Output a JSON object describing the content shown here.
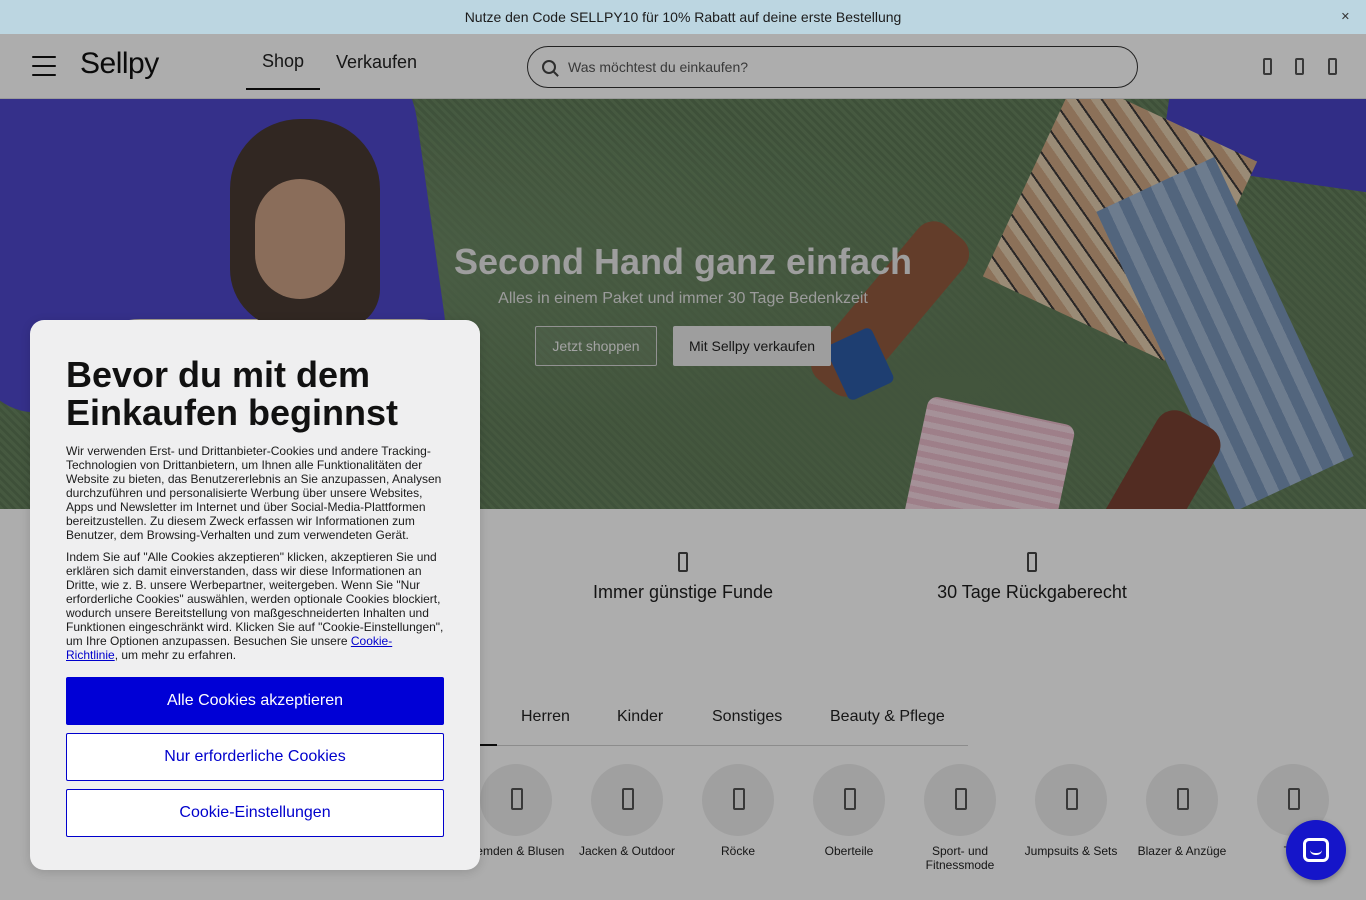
{
  "promo": {
    "text": "Nutze den Code SELLPY10 für 10% Rabatt auf deine erste Bestellung",
    "close": "✕"
  },
  "header": {
    "logo": "Sellpy",
    "tabs": [
      {
        "label": "Shop"
      },
      {
        "label": "Verkaufen"
      }
    ],
    "search_placeholder": "Was möchtest du einkaufen?",
    "icons": [
      "user-icon",
      "heart-icon",
      "cart-icon"
    ]
  },
  "hero": {
    "title": "Second Hand ganz einfach",
    "subtitle": "Alles in einem Paket und immer 30 Tage Bedenkzeit",
    "btn_shop": "Jetzt shoppen",
    "btn_sell": "Mit Sellpy verkaufen"
  },
  "usps": [
    {
      "icon": "tag-icon",
      "text": "Immer günstige Funde"
    },
    {
      "icon": "return-icon",
      "text": "30 Tage Rückgaberecht"
    }
  ],
  "category_tabs": [
    "Herren",
    "Kinder",
    "Sonstiges",
    "Beauty & Pflege"
  ],
  "categories": [
    {
      "label": "Hemden & Blusen"
    },
    {
      "label": "Jacken & Outdoor"
    },
    {
      "label": "Röcke"
    },
    {
      "label": "Oberteile"
    },
    {
      "label": "Sport- und Fitnessmode"
    },
    {
      "label": "Jumpsuits & Sets"
    },
    {
      "label": "Blazer & Anzüge"
    },
    {
      "label": "Tas"
    }
  ],
  "cookie": {
    "title": "Bevor du mit dem Einkaufen beginnst",
    "para1": "Wir verwenden Erst- und Drittanbieter-Cookies und andere Tracking-Technologien von Drittanbietern, um Ihnen alle Funktionalitäten der Website zu bieten, das Benutzererlebnis an Sie anzupassen, Analysen durchzuführen und personalisierte Werbung über unsere Websites, Apps und Newsletter im Internet und über Social-Media-Plattformen bereitzustellen. Zu diesem Zweck erfassen wir Informationen zum Benutzer, dem Browsing-Verhalten und zum verwendeten Gerät.",
    "para2": "Indem Sie auf \"Alle Cookies akzeptieren\" klicken, akzeptieren Sie und erklären sich damit einverstanden, dass wir diese Informationen an Dritte, wie z. B. unsere Werbepartner, weitergeben. Wenn Sie \"Nur erforderliche Cookies\" auswählen, werden optionale Cookies blockiert, wodurch unsere Bereitstellung von maßgeschneiderten Inhalten und Funktionen eingeschränkt wird. Klicken Sie auf \"Cookie-Einstellungen\", um Ihre Optionen anzupassen. Besuchen Sie unsere ",
    "policy_link": "Cookie-Richtlinie",
    "para2_end": ", um mehr zu erfahren.",
    "btn_accept": "Alle Cookies akzeptieren",
    "btn_required": "Nur erforderliche Cookies",
    "btn_settings": "Cookie-Einstellungen"
  },
  "colors": {
    "accent": "#0000d6",
    "promo_bg": "#bcd6e1",
    "chat_bg": "#1515c9"
  }
}
